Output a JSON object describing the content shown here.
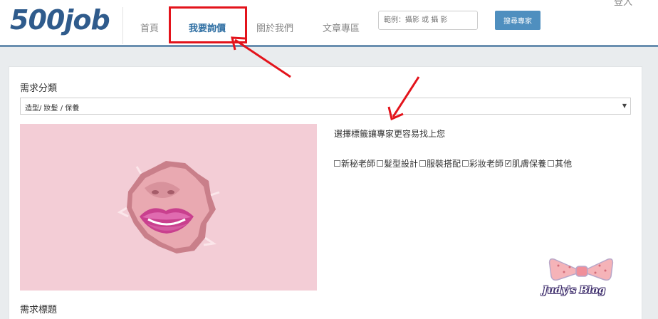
{
  "header": {
    "logo": "500job",
    "login_label": "登入",
    "nav": [
      "首頁",
      "我要詢價",
      "關於我們",
      "文章專區"
    ],
    "search": {
      "placeholder": "範例：攝影 或 攝 影",
      "button_label": "搜尋專家"
    }
  },
  "form": {
    "category_label": "需求分類",
    "category_selected": "造型/ 妝髮 / 保養",
    "tag_prompt": "選擇標籤讓專家更容易找上您",
    "tags": [
      {
        "label": "新秘老師",
        "checked": false
      },
      {
        "label": "髮型設計",
        "checked": false
      },
      {
        "label": "服裝搭配",
        "checked": false
      },
      {
        "label": "彩妝老師",
        "checked": false
      },
      {
        "label": "肌膚保養",
        "checked": true
      },
      {
        "label": "其他",
        "checked": false
      }
    ],
    "title_label": "需求標題"
  },
  "watermark": {
    "text": "Judy's Blog"
  },
  "colors": {
    "brand_blue": "#2f5b8c",
    "active_nav": "#2f6fa3",
    "annotation_red": "#e3131b",
    "header_rule": "#6a8fb0",
    "photo_pink": "#f2c9d2"
  }
}
